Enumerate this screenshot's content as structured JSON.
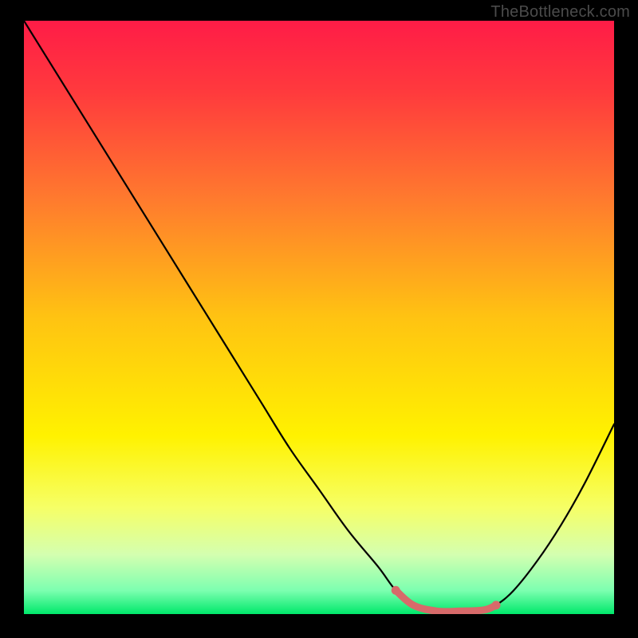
{
  "watermark": "TheBottleneck.com",
  "chart_data": {
    "type": "line",
    "title": "",
    "xlabel": "",
    "ylabel": "",
    "xlim": [
      0,
      100
    ],
    "ylim": [
      0,
      100
    ],
    "grid": false,
    "legend": false,
    "series": [
      {
        "name": "bottleneck-curve",
        "x": [
          0,
          5,
          10,
          15,
          20,
          25,
          30,
          35,
          40,
          45,
          50,
          55,
          60,
          63,
          66,
          70,
          74,
          78,
          80,
          83,
          87,
          91,
          95,
          100
        ],
        "y": [
          100,
          92,
          84,
          76,
          68,
          60,
          52,
          44,
          36,
          28,
          21,
          14,
          8,
          4,
          1.5,
          0.5,
          0.5,
          0.7,
          1.5,
          4,
          9,
          15,
          22,
          32
        ],
        "color": "#000000"
      }
    ],
    "highlight_segment": {
      "name": "sweet-spot",
      "color": "#d76a6a",
      "x": [
        63,
        66,
        70,
        74,
        78,
        80
      ],
      "y": [
        4,
        1.5,
        0.5,
        0.5,
        0.7,
        1.5
      ]
    },
    "background_gradient": {
      "stops": [
        {
          "offset": 0.0,
          "color": "#ff1c47"
        },
        {
          "offset": 0.12,
          "color": "#ff3a3d"
        },
        {
          "offset": 0.3,
          "color": "#ff7a2e"
        },
        {
          "offset": 0.5,
          "color": "#ffc312"
        },
        {
          "offset": 0.7,
          "color": "#fff200"
        },
        {
          "offset": 0.82,
          "color": "#f6ff66"
        },
        {
          "offset": 0.9,
          "color": "#d4ffb0"
        },
        {
          "offset": 0.96,
          "color": "#7dffb0"
        },
        {
          "offset": 1.0,
          "color": "#00e86b"
        }
      ]
    }
  }
}
